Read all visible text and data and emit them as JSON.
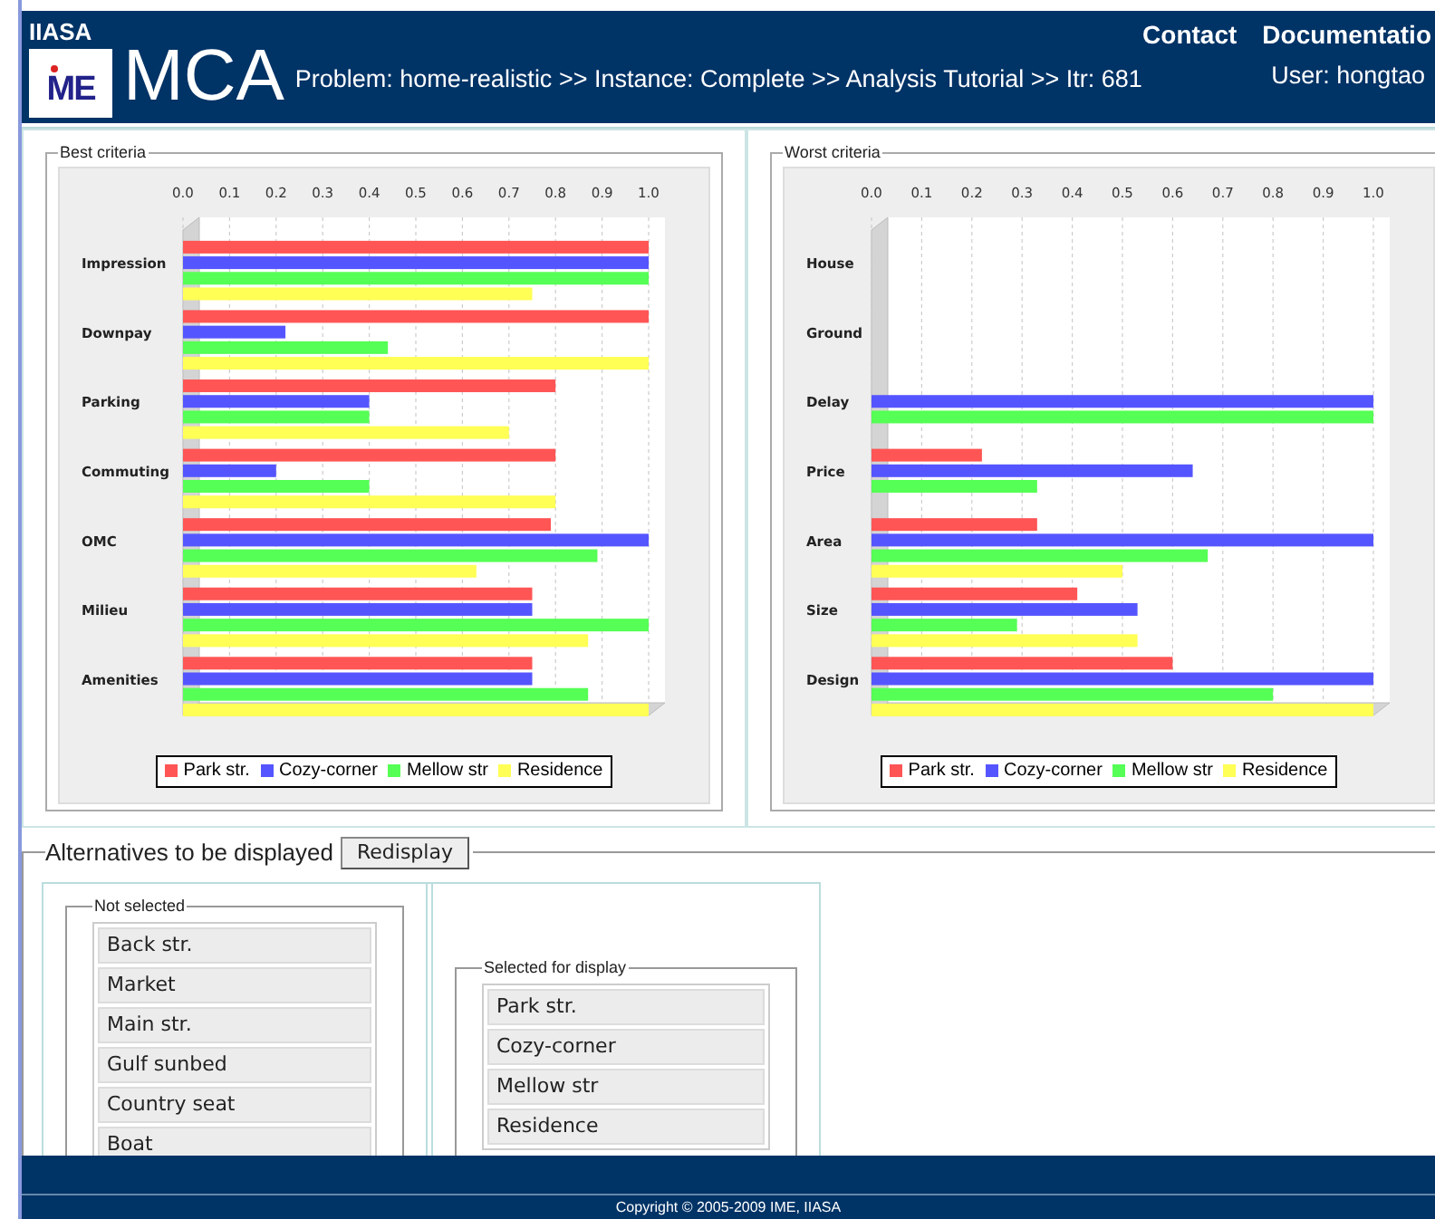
{
  "header": {
    "org": "IIASA",
    "logo_mark": "ME",
    "app": "MCA",
    "breadcrumb": "Problem: home-realistic >> Instance: Complete >> Analysis Tutorial >> Itr: 681",
    "links": [
      "Contact",
      "Documentatio"
    ],
    "user": "User: hongtao"
  },
  "charts": [
    {
      "title": "Best criteria",
      "chart_data": {
        "type": "bar",
        "orientation": "horizontal",
        "grid": true,
        "categories": [
          "Impression",
          "Downpay",
          "Parking",
          "Commuting",
          "OMC",
          "Milieu",
          "Amenities"
        ],
        "xlim": [
          0,
          1
        ],
        "xticks": [
          {
            "value": 0,
            "label": "0.0"
          },
          {
            "value": 0.1,
            "label": "0.1"
          },
          {
            "value": 0.2,
            "label": "0.2"
          },
          {
            "value": 0.3,
            "label": "0.3"
          },
          {
            "value": 0.4,
            "label": "0.4"
          },
          {
            "value": 0.5,
            "label": "0.5"
          },
          {
            "value": 0.6,
            "label": "0.6"
          },
          {
            "value": 0.7,
            "label": "0.7"
          },
          {
            "value": 0.8,
            "label": "0.8"
          },
          {
            "value": 0.9,
            "label": "0.9"
          },
          {
            "value": 1,
            "label": "1.0"
          }
        ],
        "series": [
          {
            "name": "Park str.",
            "color": "#ff5555",
            "values": [
              1.0,
              1.0,
              0.8,
              0.8,
              0.79,
              0.75,
              0.75
            ]
          },
          {
            "name": "Cozy-corner",
            "color": "#5555ff",
            "values": [
              1.0,
              0.22,
              0.4,
              0.2,
              1.0,
              0.75,
              0.75
            ]
          },
          {
            "name": "Mellow str",
            "color": "#55ff55",
            "values": [
              1.0,
              0.44,
              0.4,
              0.4,
              0.89,
              1.0,
              0.87
            ]
          },
          {
            "name": "Residence",
            "color": "#ffff55",
            "values": [
              0.75,
              1.0,
              0.7,
              0.8,
              0.63,
              0.87,
              1.0
            ]
          }
        ]
      }
    },
    {
      "title": "Worst criteria",
      "chart_data": {
        "type": "bar",
        "orientation": "horizontal",
        "grid": true,
        "categories": [
          "House",
          "Ground",
          "Delay",
          "Price",
          "Area",
          "Size",
          "Design"
        ],
        "xlim": [
          0,
          1
        ],
        "xticks": [
          {
            "value": 0,
            "label": "0.0"
          },
          {
            "value": 0.1,
            "label": "0.1"
          },
          {
            "value": 0.2,
            "label": "0.2"
          },
          {
            "value": 0.3,
            "label": "0.3"
          },
          {
            "value": 0.4,
            "label": "0.4"
          },
          {
            "value": 0.5,
            "label": "0.5"
          },
          {
            "value": 0.6,
            "label": "0.6"
          },
          {
            "value": 0.7,
            "label": "0.7"
          },
          {
            "value": 0.8,
            "label": "0.8"
          },
          {
            "value": 0.9,
            "label": "0.9"
          },
          {
            "value": 1,
            "label": "1.0"
          }
        ],
        "series": [
          {
            "name": "Park str.",
            "color": "#ff5555",
            "values": [
              null,
              null,
              null,
              0.22,
              0.33,
              0.41,
              0.6
            ]
          },
          {
            "name": "Cozy-corner",
            "color": "#5555ff",
            "values": [
              null,
              null,
              1.0,
              0.64,
              1.0,
              0.53,
              1.0
            ]
          },
          {
            "name": "Mellow str",
            "color": "#55ff55",
            "values": [
              null,
              null,
              1.0,
              0.33,
              0.67,
              0.29,
              0.8
            ]
          },
          {
            "name": "Residence",
            "color": "#ffff55",
            "values": [
              null,
              null,
              null,
              null,
              0.5,
              0.53,
              1.0
            ]
          }
        ]
      }
    }
  ],
  "alternatives": {
    "title": "Alternatives to be displayed",
    "button": "Redisplay",
    "not_selected": {
      "title": "Not selected",
      "items": [
        "Back str.",
        "Market",
        "Main str.",
        "Gulf sunbed",
        "Country seat",
        "Boat"
      ]
    },
    "selected": {
      "title": "Selected for display",
      "items": [
        "Park str.",
        "Cozy-corner",
        "Mellow str",
        "Residence"
      ]
    }
  },
  "footer": {
    "copyright": "Copyright © 2005-2009 IME, IIASA"
  }
}
